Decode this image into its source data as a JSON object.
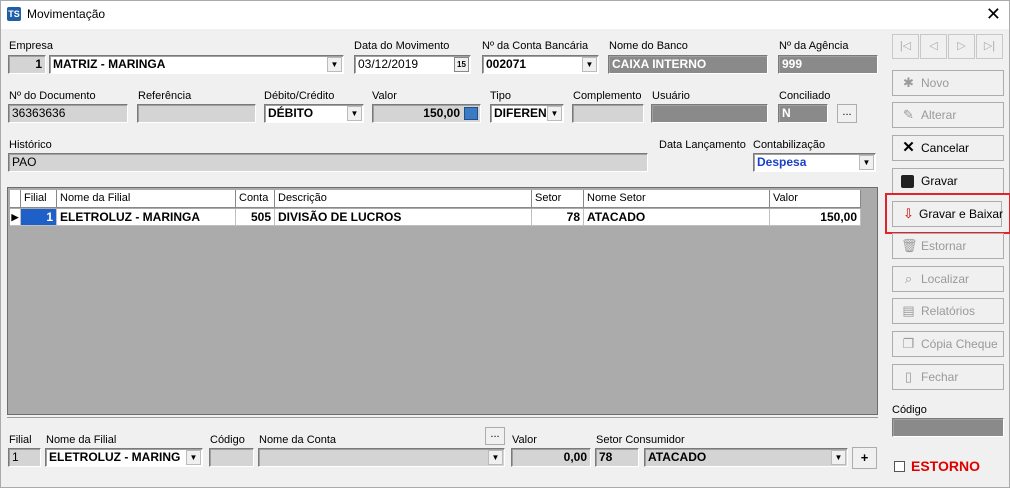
{
  "window": {
    "title": "Movimentação",
    "app_icon_text": "TS"
  },
  "form": {
    "empresa": {
      "label": "Empresa",
      "code": "1",
      "name": "MATRIZ - MARINGA"
    },
    "data_movimento": {
      "label": "Data do Movimento",
      "value": "03/12/2019",
      "cal_icon_text": "15"
    },
    "conta_bancaria": {
      "label": "Nº da Conta Bancária",
      "value": "002071"
    },
    "nome_banco": {
      "label": "Nome do Banco",
      "value": "CAIXA INTERNO"
    },
    "agencia": {
      "label": "Nº da Agência",
      "value": "999"
    },
    "documento": {
      "label": "Nº do Documento",
      "value": "36363636"
    },
    "referencia": {
      "label": "Referência",
      "value": ""
    },
    "debito_credito": {
      "label": "Débito/Crédito",
      "value": "DÉBITO"
    },
    "valor": {
      "label": "Valor",
      "value": "150,00"
    },
    "tipo": {
      "label": "Tipo",
      "value": "DIFEREN"
    },
    "complemento": {
      "label": "Complemento",
      "value": ""
    },
    "usuario": {
      "label": "Usuário",
      "value": ""
    },
    "conciliado": {
      "label": "Conciliado",
      "value": "N",
      "ellipsis": "..."
    },
    "historico": {
      "label": "Histórico",
      "value": "PAO"
    },
    "data_lancamento": {
      "label": "Data Lançamento"
    },
    "contabilizacao": {
      "label": "Contabilização",
      "value": "Despesa"
    }
  },
  "grid": {
    "headers": [
      "Filial",
      "Nome da Filial",
      "Conta",
      "Descrição",
      "Setor",
      "Nome Setor",
      "Valor"
    ],
    "rows": [
      {
        "filial": "1",
        "nome_filial": "ELETROLUZ - MARINGA",
        "conta": "505",
        "descricao": "DIVISÃO DE LUCROS",
        "setor": "78",
        "nome_setor": "ATACADO",
        "valor": "150,00"
      }
    ]
  },
  "bottom": {
    "filial": {
      "label": "Filial",
      "value": "1"
    },
    "nome_filial": {
      "label": "Nome da Filial",
      "value": "ELETROLUZ - MARING"
    },
    "codigo": {
      "label": "Código",
      "value": ""
    },
    "nome_conta": {
      "label": "Nome da Conta",
      "value": "",
      "ellipsis": "..."
    },
    "valor": {
      "label": "Valor",
      "value": "0,00"
    },
    "setor_consumidor": {
      "label": "Setor Consumidor",
      "code": "78",
      "name": "ATACADO"
    },
    "add_label": "+"
  },
  "side": {
    "nav": [
      "|◁",
      "◁",
      "▷",
      "▷|"
    ],
    "buttons": [
      {
        "label": "Novo",
        "icon": "new-icon",
        "enabled": false
      },
      {
        "label": "Alterar",
        "icon": "edit-icon",
        "enabled": false
      },
      {
        "label": "Cancelar",
        "icon": "x-icon",
        "enabled": true
      },
      {
        "label": "Gravar",
        "icon": "floppy-icon",
        "enabled": true
      },
      {
        "label": "Gravar e Baixar",
        "icon": "save-download-icon",
        "enabled": true
      },
      {
        "label": "Estornar",
        "icon": "trash-icon",
        "enabled": false
      },
      {
        "label": "Localizar",
        "icon": "magnifier-icon",
        "enabled": false
      },
      {
        "label": "Relatórios",
        "icon": "printer-icon",
        "enabled": false
      },
      {
        "label": "Cópia Cheque",
        "icon": "copy-icon",
        "enabled": false
      },
      {
        "label": "Fechar",
        "icon": "door-icon",
        "enabled": false
      }
    ],
    "codigo_label": "Código",
    "estorno_label": "ESTORNO"
  },
  "colors": {
    "highlight": "#e0242b",
    "blue_text": "#1a3fc8",
    "estorno": "#e00000"
  }
}
